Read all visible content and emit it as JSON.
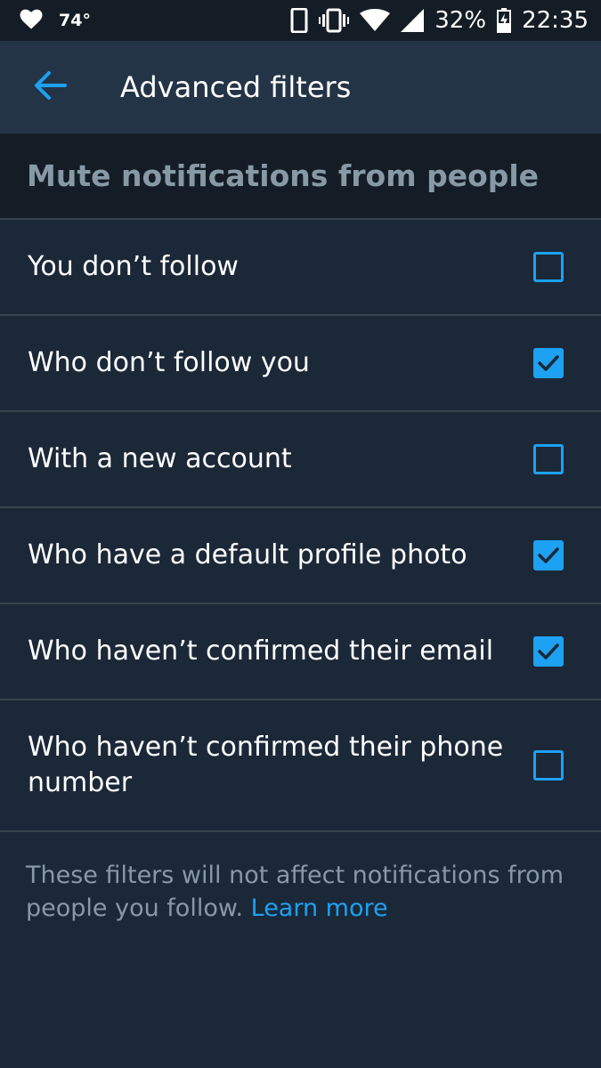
{
  "status_bar": {
    "temperature": "74°",
    "battery": "32%",
    "time": "22:35"
  },
  "header": {
    "title": "Advanced filters"
  },
  "section": {
    "title": "Mute notifications from people"
  },
  "filters": [
    {
      "label": "You don’t follow",
      "checked": false
    },
    {
      "label": "Who don’t follow you",
      "checked": true
    },
    {
      "label": "With a new account",
      "checked": false
    },
    {
      "label": "Who have a default profile photo",
      "checked": true
    },
    {
      "label": "Who haven’t confirmed their email",
      "checked": true
    },
    {
      "label": "Who haven’t confirmed their phone number",
      "checked": false
    }
  ],
  "footer": {
    "text": "These filters will not affect notifications from people you follow.",
    "link": "Learn more"
  },
  "colors": {
    "accent": "#1da1f2",
    "background": "#1b2838",
    "header_bg": "#243447",
    "section_bg": "#141d26",
    "muted_text": "#8899a6"
  }
}
